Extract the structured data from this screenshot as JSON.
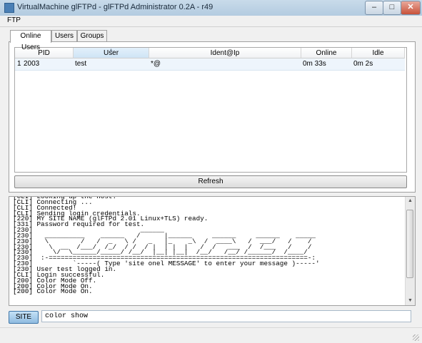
{
  "window": {
    "title": "VirtualMachine glFTPd - glFTPd Administrator 0.2A - r49",
    "minimize": "–",
    "maximize": "□",
    "close": "✕"
  },
  "menu": {
    "items": [
      "FTP"
    ]
  },
  "tabs": [
    {
      "label": "Online Users",
      "active": true
    },
    {
      "label": "Users",
      "active": false
    },
    {
      "label": "Groups",
      "active": false
    }
  ],
  "grid": {
    "columns": [
      "PID",
      "User",
      "Ident@Ip",
      "Online",
      "Idle"
    ],
    "sorted_column": "User",
    "rows": [
      {
        "index": "1",
        "pid": "2003",
        "user": "test",
        "ident": "*@",
        "online": "0m 33s",
        "idle": "0m 2s"
      }
    ]
  },
  "refresh_label": "Refresh",
  "console": {
    "lines": [
      "[CLI] Looking up the host.",
      "[CLI] Connecting ...",
      "[CLI] Connected!",
      "[CLI] Sending login credentials.",
      "[220] MY SITE NAME (glFTPd 2.01 Linux+TLS) ready.",
      "[331] Password required for test.",
      "[230]                           ______",
      "[230]   __________    ______   /      |______     ______     ______    _____",
      "[230]   \\        /   /  _   \\ /   _   |_    _\\  /  ____\\   /  ___/   /    /",
      "[230]    \\  __  /___/  /_/  / /  / |  | |  |   /  /   ___  /  /___   /    /",
      "[230]     \\/  \\______/_____/ /__/  |__| |__|  /__/   /__/ /______/  /____/",
      "[230]  :-=================================================================-:",
      "[230]          `-----( Type 'site onel MESSAGE' to enter your message )-----'",
      "[230] User test logged in.",
      "[CLI] Login successful.",
      "[200] Color Mode Off.",
      "[200] Color Mode On.",
      "[200] Color Mode On."
    ]
  },
  "command": {
    "button_label": "SITE",
    "value": "color show"
  }
}
